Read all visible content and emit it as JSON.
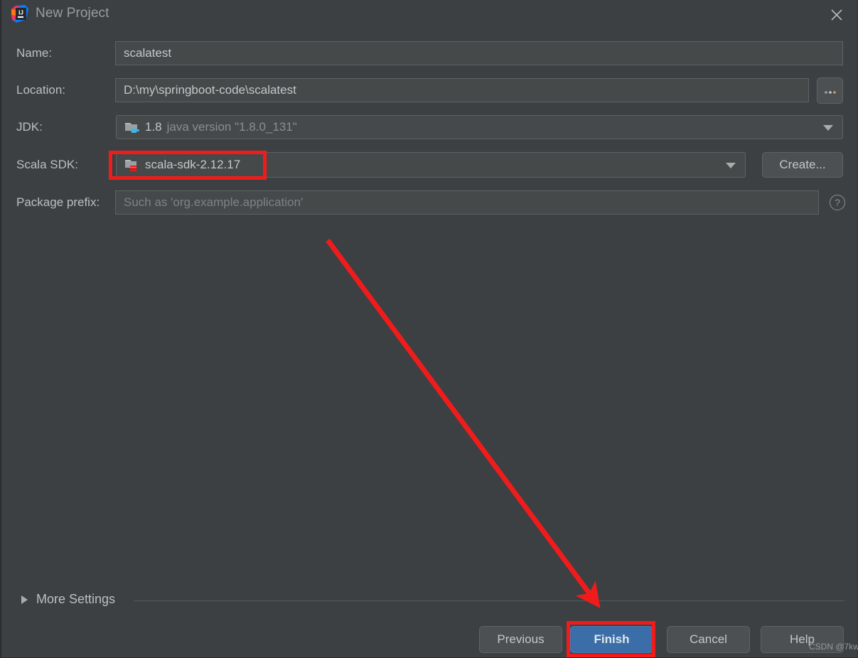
{
  "window": {
    "title": "New Project",
    "logo_icon": "intellij-idea-logo",
    "close_icon": "close-icon"
  },
  "form": {
    "name": {
      "label": "Name:",
      "value": "scalatest"
    },
    "location": {
      "label": "Location:",
      "value": "D:\\my\\springboot-code\\scalatest",
      "browse_label": "...",
      "browse_icon": "ellipsis-icon"
    },
    "jdk": {
      "label": "JDK:",
      "version": "1.8",
      "detail": "java version \"1.8.0_131\"",
      "icon": "java-folder-icon",
      "dropdown_icon": "chevron-down-icon"
    },
    "scala_sdk": {
      "label": "Scala SDK:",
      "value": "scala-sdk-2.12.17",
      "icon": "scala-folder-icon",
      "dropdown_icon": "chevron-down-icon",
      "create_label": "Create..."
    },
    "package_prefix": {
      "label": "Package prefix:",
      "value": "",
      "placeholder": "Such as 'org.example.application'",
      "help_label": "?",
      "help_icon": "question-mark-icon"
    }
  },
  "more_settings": {
    "label": "More Settings",
    "expander_icon": "chevron-right-icon"
  },
  "footer": {
    "previous_label": "Previous",
    "finish_label": "Finish",
    "cancel_label": "Cancel",
    "help_label": "Help"
  },
  "annotations": {
    "highlight_color": "#f01c1c",
    "arrow_icon": "arrow-down-right-icon"
  },
  "watermark": {
    "text": "CSDN @7kw"
  },
  "colors": {
    "dialog_background": "#3c4042",
    "field_background": "#45494a",
    "field_border": "#5e6264",
    "primary_button": "#3b6ea8",
    "text": "#bdbfc1",
    "muted_text": "#7e8285"
  }
}
